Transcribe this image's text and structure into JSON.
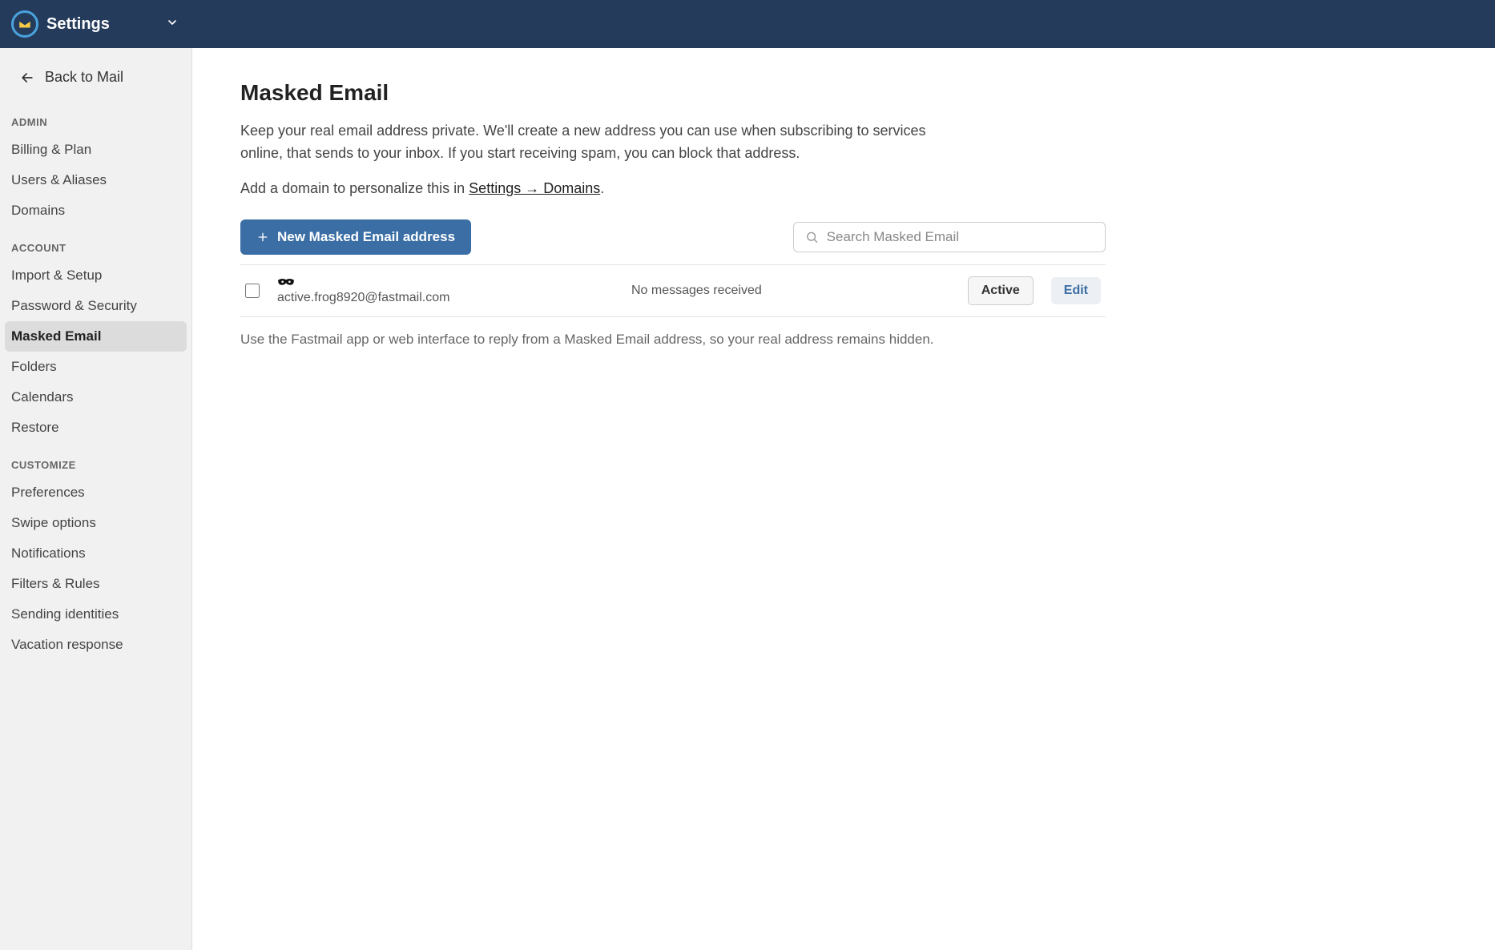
{
  "header": {
    "title": "Settings"
  },
  "sidebar": {
    "back_label": "Back to Mail",
    "sections": {
      "admin": {
        "label": "ADMIN",
        "items": [
          "Billing & Plan",
          "Users & Aliases",
          "Domains"
        ]
      },
      "account": {
        "label": "ACCOUNT",
        "items": [
          "Import & Setup",
          "Password & Security",
          "Masked Email",
          "Folders",
          "Calendars",
          "Restore"
        ],
        "active_index": 2
      },
      "customize": {
        "label": "CUSTOMIZE",
        "items": [
          "Preferences",
          "Swipe options",
          "Notifications",
          "Filters & Rules",
          "Sending identities",
          "Vacation response"
        ]
      }
    }
  },
  "main": {
    "title": "Masked Email",
    "intro1": "Keep your real email address private. We'll create a new address you can use when subscribing to services online, that sends to your inbox. If you start receiving spam, you can block that address.",
    "intro2_prefix": "Add a domain to personalize this in ",
    "intro2_link": "Settings → Domains",
    "intro2_suffix": ".",
    "new_button": "New Masked Email address",
    "search_placeholder": "Search Masked Email",
    "rows": [
      {
        "email": "active.frog8920@fastmail.com",
        "messages": "No messages received",
        "status": "Active",
        "edit_label": "Edit"
      }
    ],
    "footnote": "Use the Fastmail app or web interface to reply from a Masked Email address, so your real address remains hidden."
  }
}
